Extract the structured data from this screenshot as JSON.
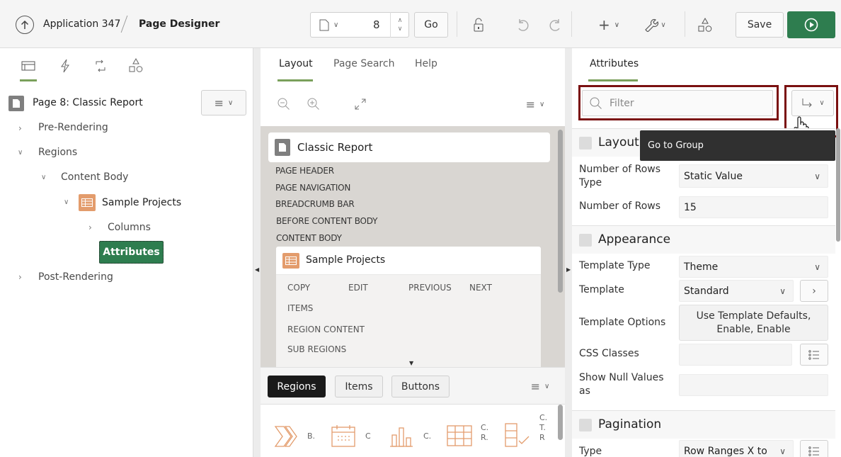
{
  "topbar": {
    "app_name": "Application 347",
    "page_designer": "Page Designer",
    "page_number": "8",
    "go_label": "Go",
    "save_label": "Save"
  },
  "left": {
    "page_title": "Page 8: Classic Report",
    "tree": {
      "pre_rendering": "Pre-Rendering",
      "regions": "Regions",
      "content_body": "Content Body",
      "sample_projects": "Sample Projects",
      "columns": "Columns",
      "attributes": "Attributes",
      "post_rendering": "Post-Rendering"
    }
  },
  "middle": {
    "tabs": [
      "Layout",
      "Page Search",
      "Help"
    ],
    "report_title": "Classic Report",
    "positions": [
      "PAGE HEADER",
      "PAGE NAVIGATION",
      "BREADCRUMB BAR",
      "BEFORE CONTENT BODY",
      "CONTENT BODY"
    ],
    "region_title": "Sample Projects",
    "slots": {
      "copy": "COPY",
      "edit": "EDIT",
      "previous": "PREVIOUS",
      "next": "NEXT",
      "items": "ITEMS",
      "region_content": "REGION CONTENT",
      "sub_regions": "SUB REGIONS"
    },
    "gallery_tabs": [
      "Regions",
      "Items",
      "Buttons"
    ],
    "gallery_labels": [
      "B.",
      "C",
      "C.",
      "C.\nR.",
      "C.\nT.\nR"
    ]
  },
  "right": {
    "tab": "Attributes",
    "filter_placeholder": "Filter",
    "tooltip": "Go to Group",
    "sections": {
      "layout": "Layout",
      "appearance": "Appearance",
      "pagination": "Pagination"
    },
    "fields": {
      "rows_type_label": "Number of Rows Type",
      "rows_type_value": "Static Value",
      "rows_label": "Number of Rows",
      "rows_value": "15",
      "template_type_label": "Template Type",
      "template_type_value": "Theme",
      "template_label": "Template",
      "template_value": "Standard",
      "template_options_label": "Template Options",
      "template_options_value": "Use Template Defaults, Enable, Enable",
      "css_classes_label": "CSS Classes",
      "show_null_label": "Show Null Values as",
      "type_label": "Type",
      "type_value": "Row Ranges X to"
    }
  },
  "colors": {
    "accent_green": "#2e7d4f",
    "highlight_red": "#7a1010",
    "tab_underline": "#7aa05b"
  }
}
